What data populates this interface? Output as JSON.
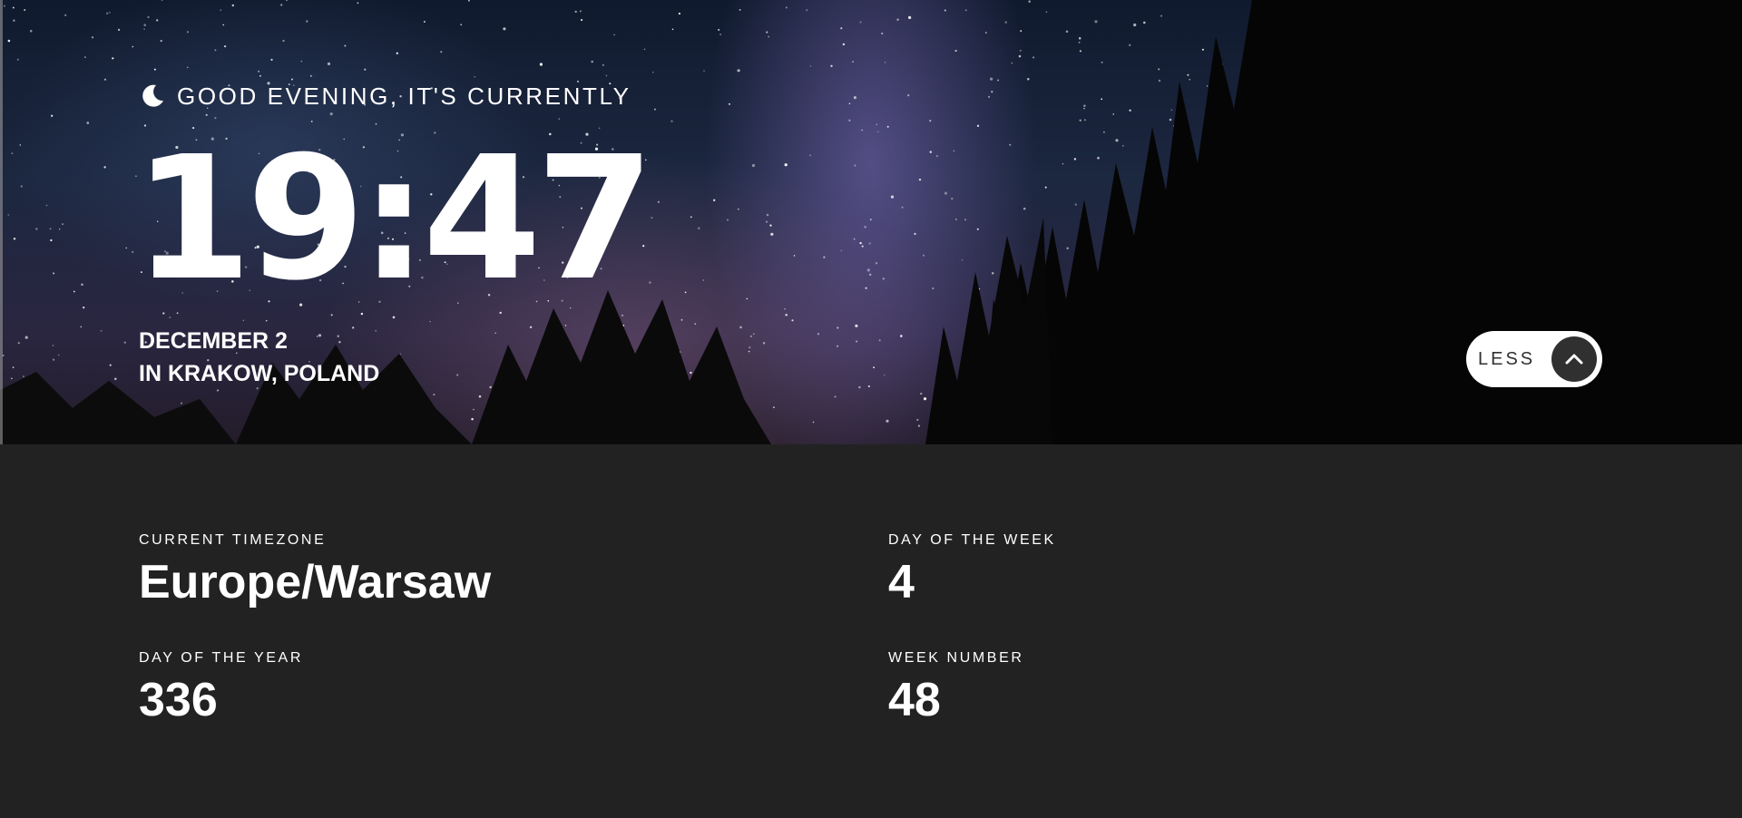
{
  "colors": {
    "details_background": "#222222",
    "text": "#ffffff",
    "toggle_background": "#ffffff",
    "toggle_circle": "#303030"
  },
  "hero": {
    "greeting_icon": "moon-icon",
    "greeting": "GOOD EVENING, IT'S CURRENTLY",
    "time": "19:47",
    "date": "DECEMBER 2",
    "location": "IN KRAKOW, POLAND"
  },
  "toggle": {
    "label": "LESS",
    "icon": "chevron-up-icon"
  },
  "details": {
    "timezone": {
      "label": "CURRENT TIMEZONE",
      "value": "Europe/Warsaw"
    },
    "day_of_week": {
      "label": "DAY OF THE WEEK",
      "value": "4"
    },
    "day_of_year": {
      "label": "DAY OF THE YEAR",
      "value": "336"
    },
    "week_number": {
      "label": "WEEK NUMBER",
      "value": "48"
    }
  }
}
